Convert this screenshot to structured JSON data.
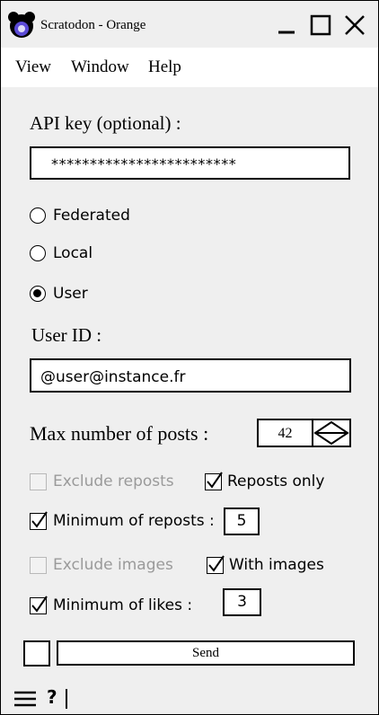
{
  "window": {
    "title": "Scratodon - Orange",
    "icons": {
      "app": "app-logo-icon",
      "minimize": "minimize-icon",
      "maximize": "maximize-icon",
      "close": "close-icon"
    }
  },
  "menu": [
    "View",
    "Window",
    "Help"
  ],
  "form": {
    "api_key_label": "API key (optional) :",
    "api_key_value": "************************",
    "radios": [
      {
        "label": "Federated",
        "selected": false
      },
      {
        "label": "Local",
        "selected": false
      },
      {
        "label": "User",
        "selected": true
      }
    ],
    "user_id_label": "User ID :",
    "user_id_value": "@user@instance.fr",
    "max_posts_label": "Max number of posts :",
    "max_posts_value": "42",
    "exclude_reposts_label": "Exclude reposts",
    "reposts_only_label": "Reposts only",
    "min_reposts_label": "Minimum of reposts :",
    "min_reposts_value": "5",
    "exclude_images_label": "Exclude images",
    "with_images_label": "With images",
    "min_likes_label": "Minimum of likes :",
    "min_likes_value": "3"
  },
  "bottom": {
    "send_label": "Send",
    "help_label": "?",
    "icons": {
      "menu": "hamburger-menu-icon"
    }
  }
}
